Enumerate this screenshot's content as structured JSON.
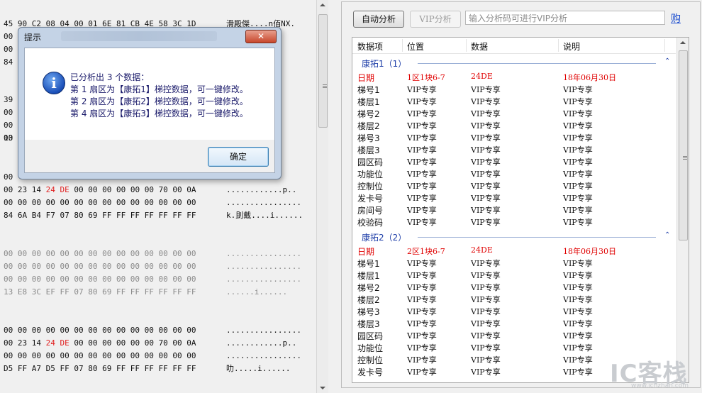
{
  "hex": {
    "lines": [
      {
        "hex": "45 90 C2 08 04 00 01 6E 81 CB 4E 58 3C 1D",
        "ascii": "滑殿傑....n佰NX.",
        "gray": false
      },
      {
        "hex": "00",
        "ascii": "..",
        "gray": false
      },
      {
        "hex": "00",
        "ascii": "..",
        "gray": false
      },
      {
        "hex": "84",
        "ascii": "..",
        "gray": false
      },
      {
        "hex": "39",
        "ascii": "..",
        "gray": false
      },
      {
        "hex": "00",
        "ascii": "..",
        "gray": false
      },
      {
        "hex": "00",
        "ascii": ".p..",
        "gray": false
      },
      {
        "hex": "00",
        "ascii": "..",
        "gray": false
      },
      {
        "hex": "13",
        "ascii": "",
        "gray": false
      },
      {
        "hex": "00",
        "ascii": "..",
        "gray": false
      },
      {
        "hex_pre": "00 23 14 ",
        "hex_red": "24 DE",
        "hex_post": " 00 00 00 00 00 00 70 00 0A",
        "ascii": "............p..",
        "gray": false
      },
      {
        "hex": "00 00 00 00 00 00 00 00 00 00 00 00 00 00",
        "ascii": "................",
        "gray": false
      },
      {
        "hex": "84 6A B4 F7 07 80 69 FF FF FF FF FF FF FF",
        "ascii": "k.刞戴....i......",
        "gray": false
      },
      {
        "hex": "00 00 00 00 00 00 00 00 00 00 00 00 00 00",
        "ascii": "................",
        "gray": true
      },
      {
        "hex": "00 00 00 00 00 00 00 00 00 00 00 00 00 00",
        "ascii": "................",
        "gray": true
      },
      {
        "hex": "00 00 00 00 00 00 00 00 00 00 00 00 00 00",
        "ascii": "................",
        "gray": true
      },
      {
        "hex": "13 E8 3C EF FF 07 80 69 FF FF FF FF FF FF",
        "ascii": "......i......",
        "gray": true
      },
      {
        "hex": "00 00 00 00 00 00 00 00 00 00 00 00 00 00",
        "ascii": "................",
        "gray": false
      },
      {
        "hex_pre": "00 23 14 ",
        "hex_red": "24 DE",
        "hex_post": " 00 00 00 00 00 00 70 00 0A",
        "ascii": "............p..",
        "gray": false
      },
      {
        "hex": "00 00 00 00 00 00 00 00 00 00 00 00 00 00",
        "ascii": "................",
        "gray": false
      },
      {
        "hex": "D5 FF A7 D5 FF 07 80 69 FF FF FF FF FF FF",
        "ascii": "叻.....i......",
        "gray": false
      }
    ]
  },
  "dialog": {
    "title": "提示",
    "close_label": "✕",
    "message_lines": [
      "已分析出 3 个数据：",
      "第 1 扇区为【康拓1】梯控数据，可一键修改。",
      "第 2 扇区为【康拓2】梯控数据，可一键修改。",
      "第 4 扇区为【康拓3】梯控数据，可一键修改。"
    ],
    "icon": "info-icon",
    "ok_label": "确定"
  },
  "toolbar": {
    "auto_label": "自动分析",
    "vip_label": "VIP分析",
    "code_placeholder": "输入分析码可进行VIP分析",
    "buy_label": "购"
  },
  "table": {
    "headers": [
      "数据项",
      "位置",
      "数据",
      "说明"
    ],
    "groups": [
      {
        "title": "康拓1（1）",
        "rows": [
          {
            "item": "日期",
            "pos": "1区1块6-7",
            "data": "24DE",
            "desc": "18年06月30日",
            "highlight": true
          },
          {
            "item": "梯号1",
            "pos": "VIP专享",
            "data": "VIP专享",
            "desc": "VIP专享",
            "highlight": false
          },
          {
            "item": "楼层1",
            "pos": "VIP专享",
            "data": "VIP专享",
            "desc": "VIP专享",
            "highlight": false
          },
          {
            "item": "梯号2",
            "pos": "VIP专享",
            "data": "VIP专享",
            "desc": "VIP专享",
            "highlight": false
          },
          {
            "item": "楼层2",
            "pos": "VIP专享",
            "data": "VIP专享",
            "desc": "VIP专享",
            "highlight": false
          },
          {
            "item": "梯号3",
            "pos": "VIP专享",
            "data": "VIP专享",
            "desc": "VIP专享",
            "highlight": false
          },
          {
            "item": "楼层3",
            "pos": "VIP专享",
            "data": "VIP专享",
            "desc": "VIP专享",
            "highlight": false
          },
          {
            "item": "园区码",
            "pos": "VIP专享",
            "data": "VIP专享",
            "desc": "VIP专享",
            "highlight": false
          },
          {
            "item": "功能位",
            "pos": "VIP专享",
            "data": "VIP专享",
            "desc": "VIP专享",
            "highlight": false
          },
          {
            "item": "控制位",
            "pos": "VIP专享",
            "data": "VIP专享",
            "desc": "VIP专享",
            "highlight": false
          },
          {
            "item": "发卡号",
            "pos": "VIP专享",
            "data": "VIP专享",
            "desc": "VIP专享",
            "highlight": false
          },
          {
            "item": "房间号",
            "pos": "VIP专享",
            "data": "VIP专享",
            "desc": "VIP专享",
            "highlight": false
          },
          {
            "item": "校验码",
            "pos": "VIP专享",
            "data": "VIP专享",
            "desc": "VIP专享",
            "highlight": false
          }
        ]
      },
      {
        "title": "康拓2（2）",
        "rows": [
          {
            "item": "日期",
            "pos": "2区1块6-7",
            "data": "24DE",
            "desc": "18年06月30日",
            "highlight": true
          },
          {
            "item": "梯号1",
            "pos": "VIP专享",
            "data": "VIP专享",
            "desc": "VIP专享",
            "highlight": false
          },
          {
            "item": "楼层1",
            "pos": "VIP专享",
            "data": "VIP专享",
            "desc": "VIP专享",
            "highlight": false
          },
          {
            "item": "梯号2",
            "pos": "VIP专享",
            "data": "VIP专享",
            "desc": "VIP专享",
            "highlight": false
          },
          {
            "item": "楼层2",
            "pos": "VIP专享",
            "data": "VIP专享",
            "desc": "VIP专享",
            "highlight": false
          },
          {
            "item": "梯号3",
            "pos": "VIP专享",
            "data": "VIP专享",
            "desc": "VIP专享",
            "highlight": false
          },
          {
            "item": "楼层3",
            "pos": "VIP专享",
            "data": "VIP专享",
            "desc": "VIP专享",
            "highlight": false
          },
          {
            "item": "园区码",
            "pos": "VIP专享",
            "data": "VIP专享",
            "desc": "VIP专享",
            "highlight": false
          },
          {
            "item": "功能位",
            "pos": "VIP专享",
            "data": "VIP专享",
            "desc": "VIP专享",
            "highlight": false
          },
          {
            "item": "控制位",
            "pos": "VIP专享",
            "data": "VIP专享",
            "desc": "VIP专享",
            "highlight": false
          },
          {
            "item": "发卡号",
            "pos": "VIP专享",
            "data": "VIP专享",
            "desc": "VIP专享",
            "highlight": false
          }
        ]
      }
    ]
  },
  "watermark": {
    "text": "IC客栈",
    "url": "www.icnzhan.com"
  },
  "colors": {
    "highlight": "#e00000",
    "group_title": "#1e3ea8",
    "link": "#1e4fcf"
  }
}
